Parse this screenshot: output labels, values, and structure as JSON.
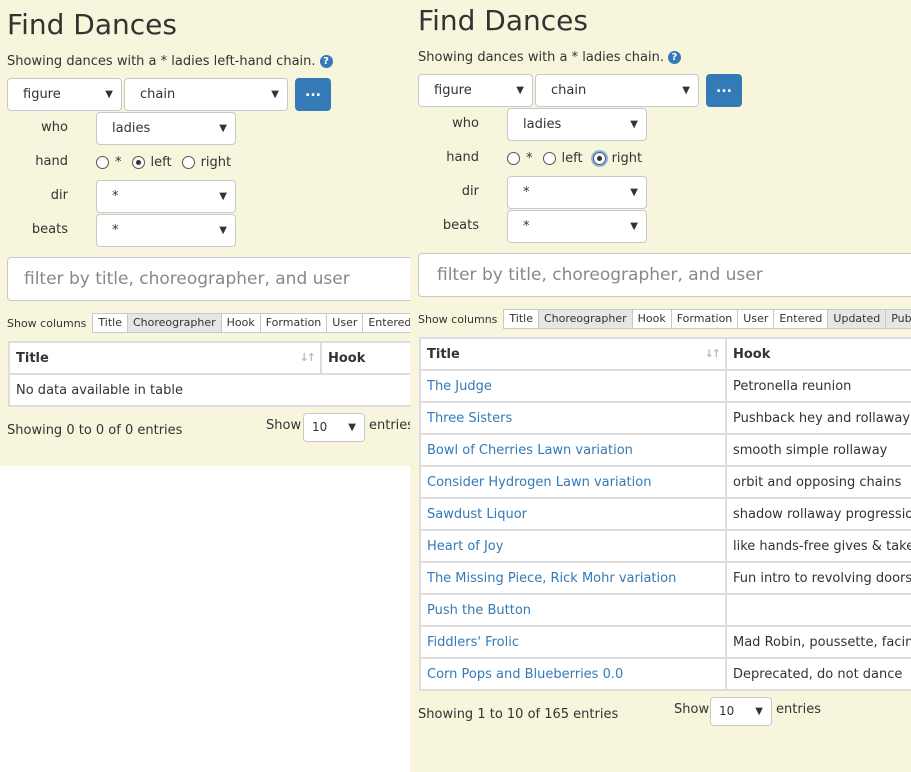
{
  "left": {
    "title": "Find Dances",
    "subtitle": "Showing dances with a * ladies left-hand chain.",
    "help_icon": "?",
    "figure_select": "figure",
    "chain_select": "chain",
    "dots_label": "...",
    "who_label": "who",
    "who_value": "ladies",
    "hand_label": "hand",
    "hand_options": [
      "*",
      "left",
      "right"
    ],
    "hand_selected": "left",
    "dir_label": "dir",
    "dir_value": "*",
    "beats_label": "beats",
    "beats_value": "*",
    "filter_placeholder": "filter by title, choreographer, and user",
    "show_columns_label": "Show columns",
    "columns": [
      "Title",
      "Choreographer",
      "Hook",
      "Formation",
      "User",
      "Entered",
      "U"
    ],
    "columns_active": [
      "Choreographer"
    ],
    "table_headers": [
      "Title",
      "Hook"
    ],
    "empty_message": "No data available in table",
    "info": "Showing 0 to 0 of 0 entries",
    "show_label": "Show",
    "page_length": "10",
    "entries_label": "entries"
  },
  "right": {
    "title": "Find Dances",
    "subtitle": "Showing dances with a * ladies chain.",
    "help_icon": "?",
    "figure_select": "figure",
    "chain_select": "chain",
    "dots_label": "...",
    "who_label": "who",
    "who_value": "ladies",
    "hand_label": "hand",
    "hand_options": [
      "*",
      "left",
      "right"
    ],
    "hand_selected": "right",
    "dir_label": "dir",
    "dir_value": "*",
    "beats_label": "beats",
    "beats_value": "*",
    "filter_placeholder": "filter by title, choreographer, and user",
    "show_columns_label": "Show columns",
    "columns": [
      "Title",
      "Choreographer",
      "Hook",
      "Formation",
      "User",
      "Entered",
      "Updated",
      "Publishe"
    ],
    "columns_active": [
      "Choreographer",
      "Updated",
      "Publishe"
    ],
    "table_headers": [
      "Title",
      "Hook"
    ],
    "rows": [
      {
        "title": "The Judge",
        "hook": "Petronella reunion"
      },
      {
        "title": "Three Sisters",
        "hook": "Pushback hey and rollaway"
      },
      {
        "title": "Bowl of Cherries Lawn variation",
        "hook": "smooth simple rollaway"
      },
      {
        "title": "Consider Hydrogen Lawn variation",
        "hook": "orbit and opposing chains"
      },
      {
        "title": "Sawdust Liquor",
        "hook": "shadow rollaway progression"
      },
      {
        "title": "Heart of Joy",
        "hook": "like hands-free gives & takes,"
      },
      {
        "title": "The Missing Piece, Rick Mohr variation",
        "hook": "Fun intro to revolving doors"
      },
      {
        "title": "Push the Button",
        "hook": ""
      },
      {
        "title": "Fiddlers' Frolic",
        "hook": "Mad Robin, poussette, facing s"
      },
      {
        "title": "Corn Pops and Blueberries 0.0",
        "hook": "Deprecated, do not dance"
      }
    ],
    "info": "Showing 1 to 10 of 165 entries",
    "show_label": "Show",
    "page_length": "10",
    "entries_label": "entries"
  }
}
